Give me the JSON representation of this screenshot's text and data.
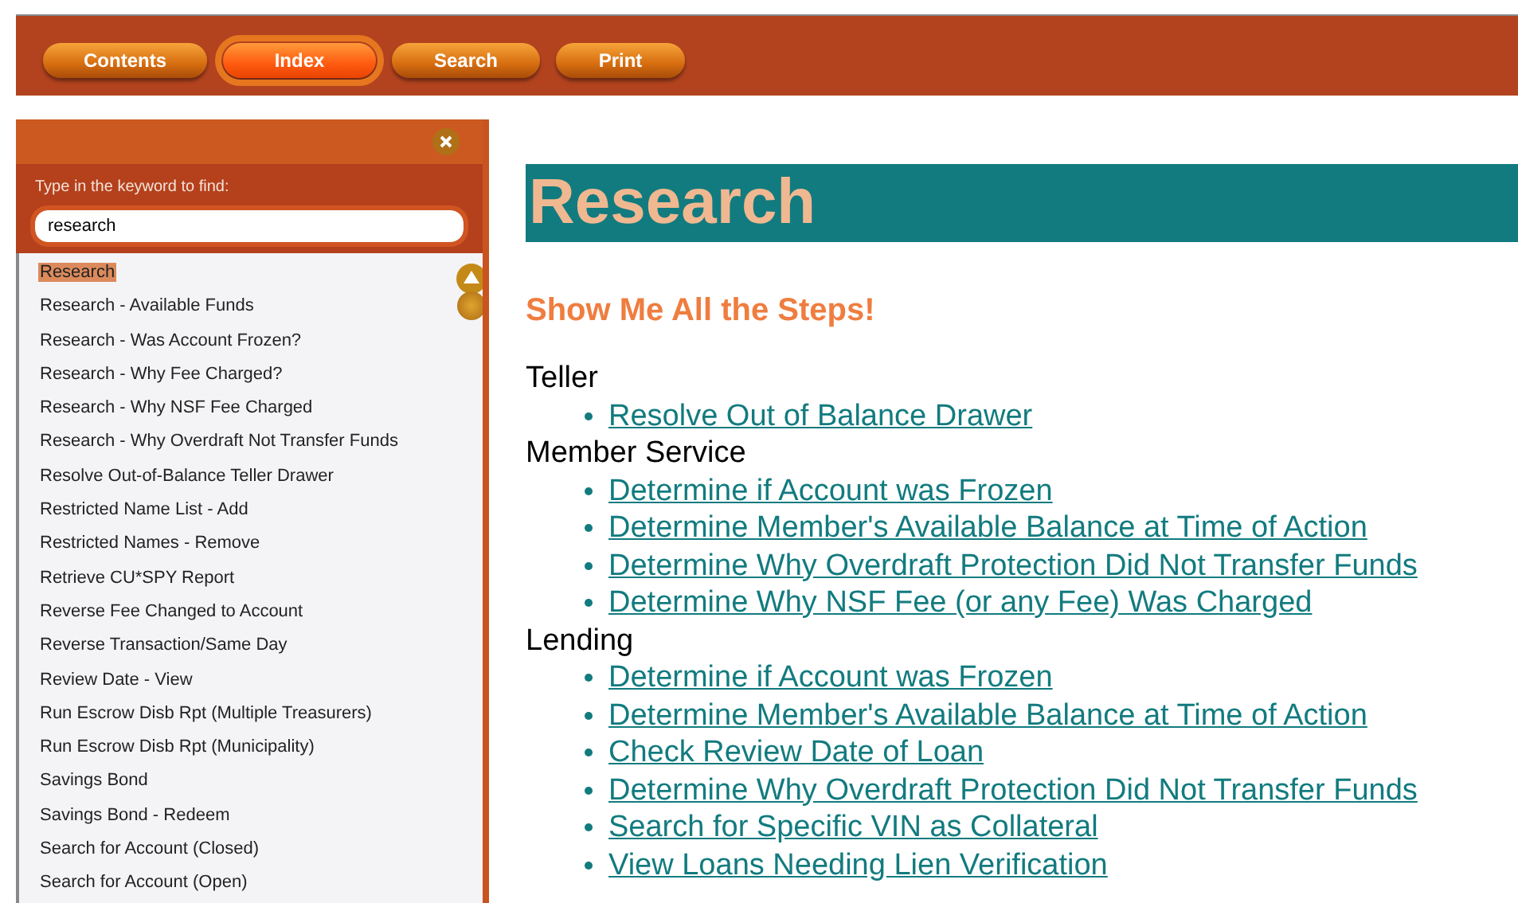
{
  "toolbar": {
    "tabs": [
      {
        "label": "Contents",
        "selected": false
      },
      {
        "label": "Index",
        "selected": true
      },
      {
        "label": "Search",
        "selected": false
      },
      {
        "label": "Print",
        "selected": false
      }
    ]
  },
  "index_panel": {
    "prompt": "Type in the keyword to find:",
    "keyword": "research",
    "items": [
      {
        "label": "Research",
        "selected": true
      },
      {
        "label": "Research - Available Funds",
        "selected": false
      },
      {
        "label": "Research - Was Account Frozen?",
        "selected": false
      },
      {
        "label": "Research - Why Fee Charged?",
        "selected": false
      },
      {
        "label": "Research - Why NSF Fee Charged",
        "selected": false
      },
      {
        "label": "Research - Why Overdraft Not Transfer Funds",
        "selected": false
      },
      {
        "label": "Resolve Out-of-Balance Teller Drawer",
        "selected": false
      },
      {
        "label": "Restricted Name List - Add",
        "selected": false
      },
      {
        "label": "Restricted Names - Remove",
        "selected": false
      },
      {
        "label": "Retrieve CU*SPY Report",
        "selected": false
      },
      {
        "label": "Reverse Fee Changed to Account",
        "selected": false
      },
      {
        "label": "Reverse Transaction/Same Day",
        "selected": false
      },
      {
        "label": "Review Date - View",
        "selected": false
      },
      {
        "label": "Run Escrow Disb Rpt (Multiple Treasurers)",
        "selected": false
      },
      {
        "label": "Run Escrow Disb Rpt (Municipality)",
        "selected": false
      },
      {
        "label": "Savings Bond",
        "selected": false
      },
      {
        "label": "Savings Bond - Redeem",
        "selected": false
      },
      {
        "label": "Search for Account (Closed)",
        "selected": false
      },
      {
        "label": "Search for Account (Open)",
        "selected": false
      }
    ]
  },
  "article": {
    "title": "Research",
    "subtitle": "Show Me All the Steps!",
    "sections": [
      {
        "heading": "Teller",
        "links": [
          "Resolve Out of Balance Drawer"
        ]
      },
      {
        "heading": "Member Service",
        "links": [
          "Determine if Account was Frozen",
          "Determine Member's Available Balance at Time of Action",
          "Determine Why Overdraft Protection Did Not Transfer Funds",
          "Determine Why NSF Fee (or any Fee) Was Charged"
        ]
      },
      {
        "heading": "Lending",
        "links": [
          "Determine if Account was Frozen",
          "Determine Member's Available Balance at Time of Action",
          "Check Review Date of Loan",
          "Determine Why Overdraft Protection Did Not Transfer Funds",
          "Search for Specific VIN as Collateral",
          "View Loans Needing Lien Verification"
        ]
      }
    ]
  }
}
